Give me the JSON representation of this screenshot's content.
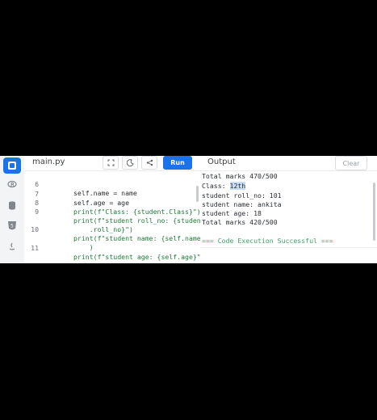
{
  "editor": {
    "tab_label": "main.py",
    "run_label": "Run",
    "lines": [
      {
        "num": "6",
        "code": "self.name = name"
      },
      {
        "num": "7",
        "code": "self.age = age"
      },
      {
        "num": "8",
        "code": "print(f\"Class: {student.Class}\")"
      },
      {
        "num": "9",
        "code": "print(f\"student roll_no: {student"
      },
      {
        "num": "",
        "code": "    .roll_no}\")"
      },
      {
        "num": "10",
        "code": "print(f\"student name: {self.name}\""
      },
      {
        "num": "",
        "code": "    )"
      },
      {
        "num": "11",
        "code": "print(f\"student age: {self.age}\")"
      }
    ]
  },
  "output": {
    "title": "Output",
    "clear_label": "Clear",
    "lines": [
      "Total marks 470/500",
      "Class: ",
      "student roll_no: 101",
      "student name: ankita",
      "student age: 18",
      "Total marks 420/500"
    ],
    "highlighted": "12th",
    "success": "=== Code Execution Successful ==="
  },
  "colors": {
    "accent": "#1a73e8",
    "success": "#3f9f6a"
  },
  "icons": [
    "python-icon",
    "r-icon",
    "database-icon",
    "html5-icon",
    "java-icon",
    "fullscreen-icon",
    "theme-icon",
    "share-icon"
  ]
}
